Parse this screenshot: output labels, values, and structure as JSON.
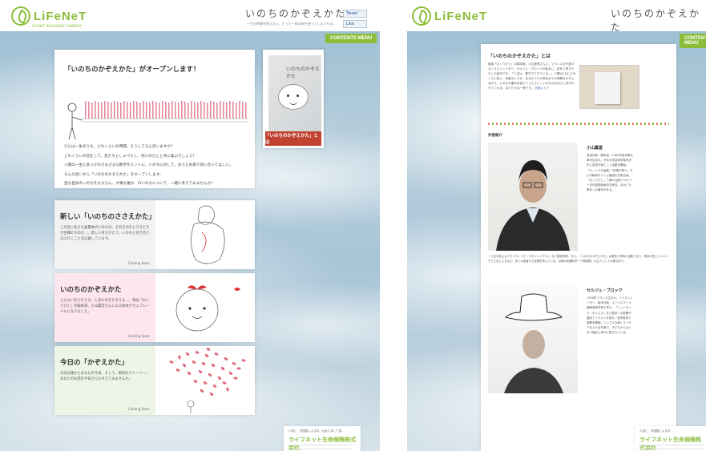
{
  "left": {
    "logo": {
      "text": "LiFeNeT",
      "sub": "LIFENET INSURANCE COMPANY"
    },
    "site_title": "いのちのかぞえかた",
    "site_sub": "一生の時間を数えると、たった一枚の紙を使ってしまうもの。",
    "social": {
      "tweet": "Tweet",
      "like": "Like"
    },
    "menu": "CONTENTS MENU",
    "hero": {
      "title": "「いのちのかぞえかた」がオープンします！",
      "paragraphs": [
        "ひとは一生のうち、どれくらいの時間、そうしてると思いますか？",
        "どれくらいの恋をして、友だちとしゃべりし、何人のひとと共に喜ぶでしょう？",
        "人間の一生に多うかのさまざまな数字をヒントに、いのちに対して、あらため目で向い合ってほしい。",
        "そんな思いから「いのちのかぞえかた」をオープンします。",
        "自分自身のいのちをもちろん、大事な誰か、のいのちについて、一緒に考えてみませんか？"
      ]
    },
    "book": {
      "title": "いのちのかぞえかた",
      "label": "「いのちのかぞえかた」とは"
    },
    "features": [
      {
        "title": "新しい「いのちのささえかた」",
        "desc": "この世に生ける並最後のいのちの。その方のひとりひとりが生輝のちのか…。新しい考えかたで、いのちと付き合う方に行くことを応援しています。",
        "coming": "Coming Soon",
        "bg": "#f2f2f2"
      },
      {
        "title": "いのちのかぞえかた",
        "desc": "じんせいをかぞえる、しあわせをかぞえる…。映画「おくりびと」の脚本家、小山薫堂さんによる絵本がウェブレーベルになりました。",
        "coming": "Coming Soon",
        "bg": "#fde6ee"
      },
      {
        "title": "今日の「かぞえかた」",
        "desc": "大切な誰かとあなたの今日、そして、明日のストーリー。あなたのお話を今日からかぞえてみませんか。",
        "coming": "Coming Soon",
        "bg": "#edf5e6"
      }
    ],
    "footer": {
      "small": "人型に、外国語による字、社会に対して宝…",
      "company": "ライフネット生命保険株式会社"
    }
  },
  "right": {
    "logo": {
      "text": "LiFeNeT"
    },
    "site_title": "いのちのかぞえかた",
    "menu": "CONTENTS MENU",
    "doc": {
      "heading": "「いのちのかぞえかた」とは",
      "intro": "映画「おくりびと」の脚本家、小山薫堂さんと、フランスを代表するイラストレーター、セルジュ・ブロックが絵本に。初めて書き下ろした絵本です。「人生は、数字でできている。」人間は1日にどれくらい笑い、何度泣くのか。生まれてから死ぬまでの時間をかぞえながら、いのちの重みを感じてください。いのちの大切さに気付かせてくれる、あたたかな一冊です。",
      "link": "日経ストア",
      "section": "作者紹介",
      "author1": {
        "name": "小山薫堂",
        "bio": "放送作家、脚本家。1964年熊本県天草市生まれ。日本大学芸術学部在学中に放送作家として活動を開始。「カノッサの屈辱」「料理の鉄人」などの斬新なテレビ番組を多数企画。「おくりびと」で第81回米アカデミー賞外国語映画賞を受賞。ほかにも数多くの著作がある。"
      },
      "caption": "「人生を変えるブランディング（マガジンハウス）」など著書多数。また、「いのちのかぞえかた」は発売と同時に話題となり、書店の売上ランキングで上位に入るなど、多くの読者から反響を呼んでいる。京都の老舗料亭「下鴨茶寮」の主人としての顔も持つ。",
      "author2": {
        "name": "セルジュ・ブロック",
        "bio": "1956年フランス生まれ。イラストレーター、絵本作家。ストラスブール装飾美術学校で学ぶ。「ニューヨーク・タイムズ」など数多くの新聞や雑誌でイラストを描き、世界各地で個展を開催。シンプルな線とユーモアあふれる作風で、子どもから大人まで幅広い世代に愛されている。"
      }
    },
    "footer": {
      "small": "人型に、外国語による字…",
      "company": "ライフネット生命保険株式会社"
    }
  }
}
